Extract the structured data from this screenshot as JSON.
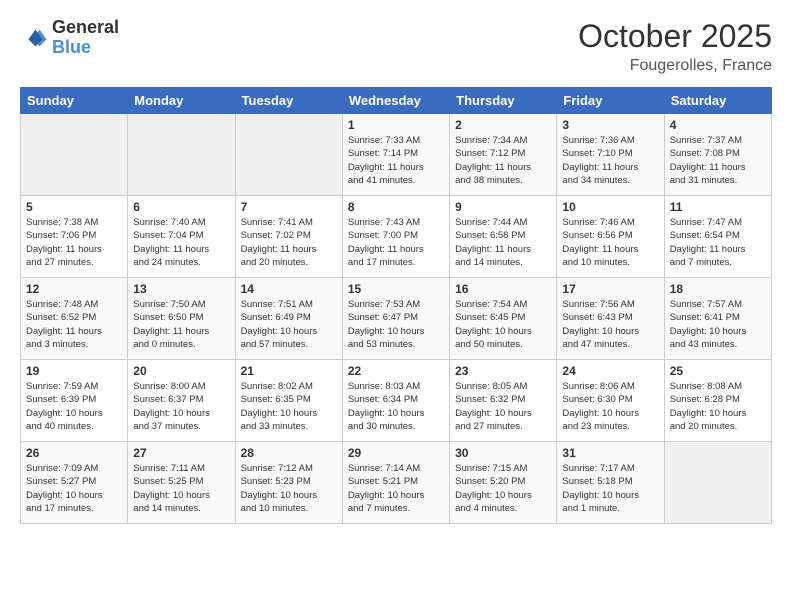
{
  "header": {
    "logo_general": "General",
    "logo_blue": "Blue",
    "month": "October 2025",
    "location": "Fougerolles, France"
  },
  "weekdays": [
    "Sunday",
    "Monday",
    "Tuesday",
    "Wednesday",
    "Thursday",
    "Friday",
    "Saturday"
  ],
  "weeks": [
    [
      {
        "day": "",
        "info": ""
      },
      {
        "day": "",
        "info": ""
      },
      {
        "day": "",
        "info": ""
      },
      {
        "day": "1",
        "info": "Sunrise: 7:33 AM\nSunset: 7:14 PM\nDaylight: 11 hours\nand 41 minutes."
      },
      {
        "day": "2",
        "info": "Sunrise: 7:34 AM\nSunset: 7:12 PM\nDaylight: 11 hours\nand 38 minutes."
      },
      {
        "day": "3",
        "info": "Sunrise: 7:36 AM\nSunset: 7:10 PM\nDaylight: 11 hours\nand 34 minutes."
      },
      {
        "day": "4",
        "info": "Sunrise: 7:37 AM\nSunset: 7:08 PM\nDaylight: 11 hours\nand 31 minutes."
      }
    ],
    [
      {
        "day": "5",
        "info": "Sunrise: 7:38 AM\nSunset: 7:06 PM\nDaylight: 11 hours\nand 27 minutes."
      },
      {
        "day": "6",
        "info": "Sunrise: 7:40 AM\nSunset: 7:04 PM\nDaylight: 11 hours\nand 24 minutes."
      },
      {
        "day": "7",
        "info": "Sunrise: 7:41 AM\nSunset: 7:02 PM\nDaylight: 11 hours\nand 20 minutes."
      },
      {
        "day": "8",
        "info": "Sunrise: 7:43 AM\nSunset: 7:00 PM\nDaylight: 11 hours\nand 17 minutes."
      },
      {
        "day": "9",
        "info": "Sunrise: 7:44 AM\nSunset: 6:58 PM\nDaylight: 11 hours\nand 14 minutes."
      },
      {
        "day": "10",
        "info": "Sunrise: 7:46 AM\nSunset: 6:56 PM\nDaylight: 11 hours\nand 10 minutes."
      },
      {
        "day": "11",
        "info": "Sunrise: 7:47 AM\nSunset: 6:54 PM\nDaylight: 11 hours\nand 7 minutes."
      }
    ],
    [
      {
        "day": "12",
        "info": "Sunrise: 7:48 AM\nSunset: 6:52 PM\nDaylight: 11 hours\nand 3 minutes."
      },
      {
        "day": "13",
        "info": "Sunrise: 7:50 AM\nSunset: 6:50 PM\nDaylight: 11 hours\nand 0 minutes."
      },
      {
        "day": "14",
        "info": "Sunrise: 7:51 AM\nSunset: 6:49 PM\nDaylight: 10 hours\nand 57 minutes."
      },
      {
        "day": "15",
        "info": "Sunrise: 7:53 AM\nSunset: 6:47 PM\nDaylight: 10 hours\nand 53 minutes."
      },
      {
        "day": "16",
        "info": "Sunrise: 7:54 AM\nSunset: 6:45 PM\nDaylight: 10 hours\nand 50 minutes."
      },
      {
        "day": "17",
        "info": "Sunrise: 7:56 AM\nSunset: 6:43 PM\nDaylight: 10 hours\nand 47 minutes."
      },
      {
        "day": "18",
        "info": "Sunrise: 7:57 AM\nSunset: 6:41 PM\nDaylight: 10 hours\nand 43 minutes."
      }
    ],
    [
      {
        "day": "19",
        "info": "Sunrise: 7:59 AM\nSunset: 6:39 PM\nDaylight: 10 hours\nand 40 minutes."
      },
      {
        "day": "20",
        "info": "Sunrise: 8:00 AM\nSunset: 6:37 PM\nDaylight: 10 hours\nand 37 minutes."
      },
      {
        "day": "21",
        "info": "Sunrise: 8:02 AM\nSunset: 6:35 PM\nDaylight: 10 hours\nand 33 minutes."
      },
      {
        "day": "22",
        "info": "Sunrise: 8:03 AM\nSunset: 6:34 PM\nDaylight: 10 hours\nand 30 minutes."
      },
      {
        "day": "23",
        "info": "Sunrise: 8:05 AM\nSunset: 6:32 PM\nDaylight: 10 hours\nand 27 minutes."
      },
      {
        "day": "24",
        "info": "Sunrise: 8:06 AM\nSunset: 6:30 PM\nDaylight: 10 hours\nand 23 minutes."
      },
      {
        "day": "25",
        "info": "Sunrise: 8:08 AM\nSunset: 6:28 PM\nDaylight: 10 hours\nand 20 minutes."
      }
    ],
    [
      {
        "day": "26",
        "info": "Sunrise: 7:09 AM\nSunset: 5:27 PM\nDaylight: 10 hours\nand 17 minutes."
      },
      {
        "day": "27",
        "info": "Sunrise: 7:11 AM\nSunset: 5:25 PM\nDaylight: 10 hours\nand 14 minutes."
      },
      {
        "day": "28",
        "info": "Sunrise: 7:12 AM\nSunset: 5:23 PM\nDaylight: 10 hours\nand 10 minutes."
      },
      {
        "day": "29",
        "info": "Sunrise: 7:14 AM\nSunset: 5:21 PM\nDaylight: 10 hours\nand 7 minutes."
      },
      {
        "day": "30",
        "info": "Sunrise: 7:15 AM\nSunset: 5:20 PM\nDaylight: 10 hours\nand 4 minutes."
      },
      {
        "day": "31",
        "info": "Sunrise: 7:17 AM\nSunset: 5:18 PM\nDaylight: 10 hours\nand 1 minute."
      },
      {
        "day": "",
        "info": ""
      }
    ]
  ]
}
